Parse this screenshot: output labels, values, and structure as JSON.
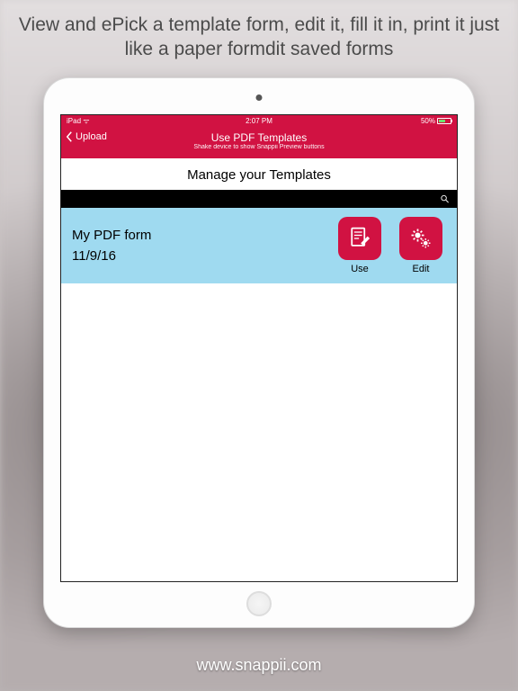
{
  "headline": "View and ePick a template form, edit it, fill it in, print it just like a paper formdit saved forms",
  "statusbar": {
    "carrier": "iPad",
    "time": "2:07 PM",
    "battery": "50%"
  },
  "navbar": {
    "back_label": "Upload",
    "title": "Use PDF Templates",
    "subtitle": "Shake device to show Snappii Preview buttons"
  },
  "subheader": "Manage your Templates",
  "template": {
    "name": "My PDF form",
    "date": "11/9/16",
    "use_label": "Use",
    "edit_label": "Edit"
  },
  "footer_url": "www.snappii.com"
}
